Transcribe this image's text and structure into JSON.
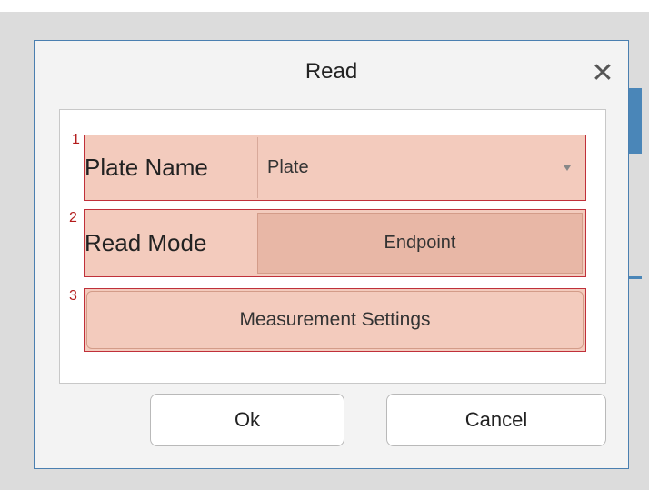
{
  "dialog": {
    "title": "Read",
    "close_glyph": "✕"
  },
  "fields": [
    {
      "index": "1",
      "label": "Plate Name",
      "value": "Plate"
    },
    {
      "index": "2",
      "label": "Read Mode",
      "value": "Endpoint"
    },
    {
      "index": "3",
      "label": "Measurement Settings"
    }
  ],
  "footer": {
    "ok_label": "Ok",
    "cancel_label": "Cancel"
  },
  "colors": {
    "highlight_fill": "#f3cbbd",
    "highlight_border": "#c0303a",
    "dialog_border": "#4a7fb0"
  }
}
